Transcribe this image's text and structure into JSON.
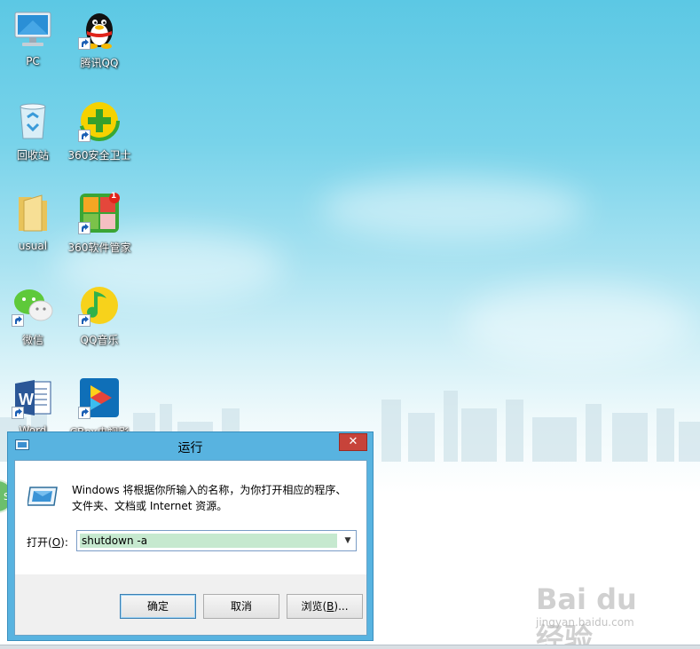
{
  "desktop": {
    "icons": [
      {
        "label": "PC",
        "icon": "computer-icon",
        "shortcut": false
      },
      {
        "label": "腾讯QQ",
        "icon": "qq-penguin-icon",
        "shortcut": true
      },
      {
        "label": "回收站",
        "icon": "recycle-bin-icon",
        "shortcut": false
      },
      {
        "label": "360安全卫士",
        "icon": "360-security-icon",
        "shortcut": true
      },
      {
        "label": "usual",
        "icon": "folder-icon",
        "shortcut": false
      },
      {
        "label": "360软件管家",
        "icon": "360-software-manager-icon",
        "shortcut": true,
        "badge": "1"
      },
      {
        "label": "微信",
        "icon": "wechat-icon",
        "shortcut": true
      },
      {
        "label": "QQ音乐",
        "icon": "qq-music-icon",
        "shortcut": true
      },
      {
        "label": "Word",
        "icon": "word-icon",
        "shortcut": true
      },
      {
        "label": "CBox央视影",
        "icon": "cbox-icon",
        "shortcut": true
      }
    ],
    "side_widget_text": "SI"
  },
  "run_dialog": {
    "title": "运行",
    "close_glyph": "✕",
    "description": "Windows 将根据你所输入的名称，为你打开相应的程序、文件夹、文档或 Internet 资源。",
    "open_label": "打开(",
    "open_accel": "O",
    "open_label_end": "):",
    "command_value": "shutdown -a",
    "dropdown_glyph": "▼",
    "buttons": {
      "ok": "确定",
      "cancel": "取消",
      "browse_prefix": "浏览(",
      "browse_accel": "B",
      "browse_suffix": ")..."
    }
  },
  "watermark": {
    "brand": "Bai du 经验",
    "url": "jingyan.baidu.com"
  },
  "colors": {
    "title_bar": "#58b3e0",
    "close_button": "#c7433a",
    "input_highlight": "#c6e9cf"
  }
}
